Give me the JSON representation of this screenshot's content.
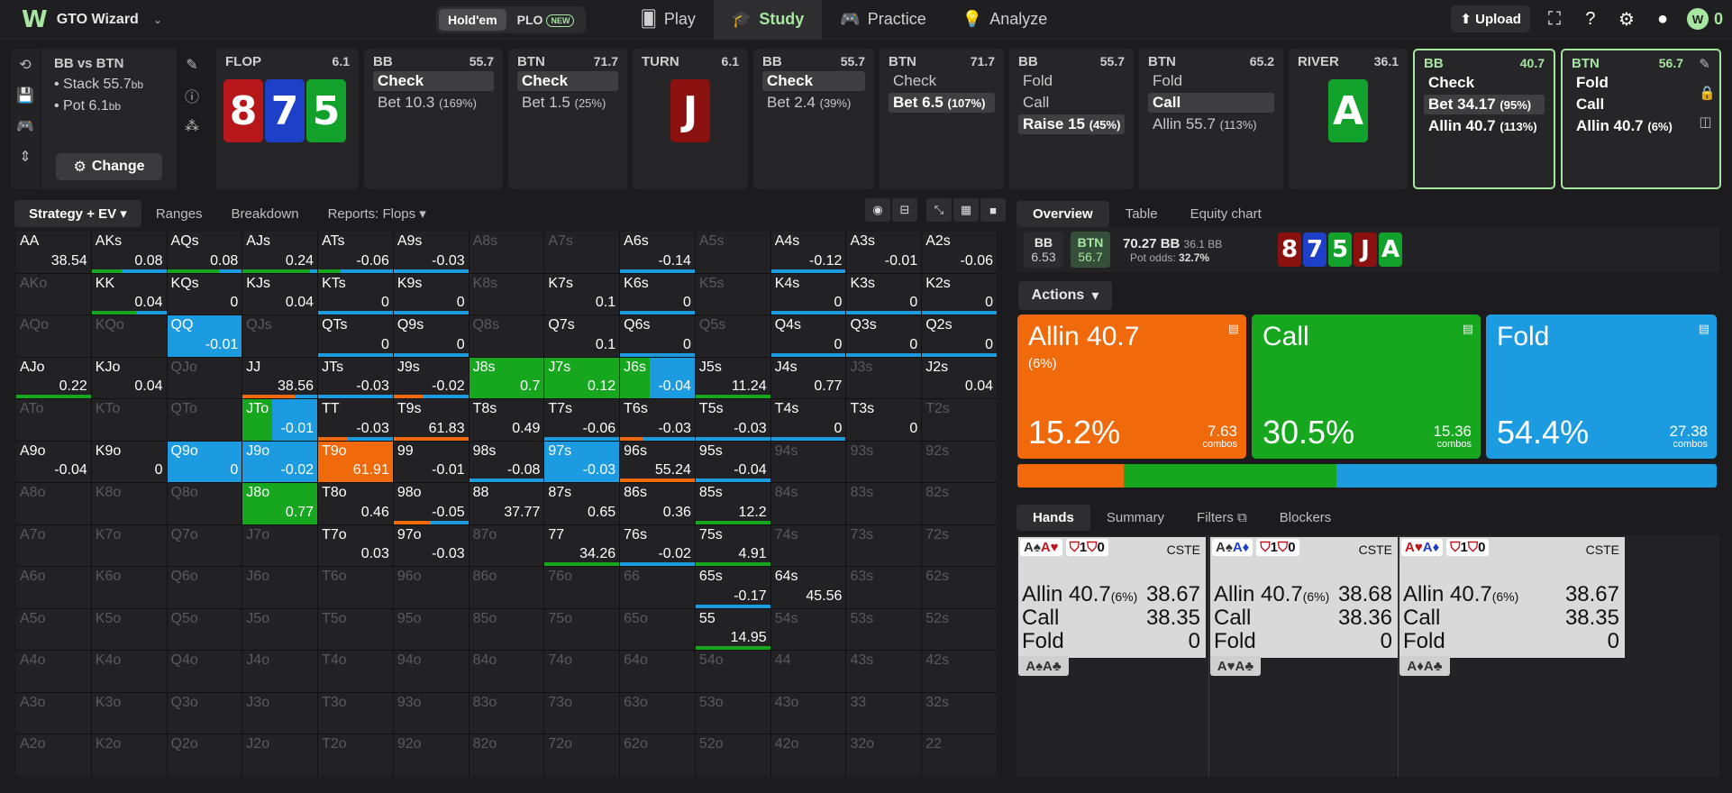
{
  "app": {
    "name": "GTO Wizard",
    "logo": "W"
  },
  "game_toggle": {
    "holdem": "Hold'em",
    "plo": "PLO",
    "new_badge": "NEW"
  },
  "nav": [
    {
      "label": "Play",
      "icon": "cards-icon"
    },
    {
      "label": "Study",
      "icon": "study-icon"
    },
    {
      "label": "Practice",
      "icon": "gamepad-icon"
    },
    {
      "label": "Analyze",
      "icon": "bulb-icon"
    }
  ],
  "top_right": {
    "upload": "Upload",
    "coins": "0"
  },
  "info": {
    "title": "BB vs BTN",
    "stack_label": "Stack 55.7",
    "pot_label": "Pot 6.1",
    "unit": "bb",
    "change": "Change"
  },
  "columns": {
    "flop": {
      "name": "FLOP",
      "pot": "6.1",
      "cards": [
        "8",
        "7",
        "5"
      ]
    },
    "bb1": {
      "name": "BB",
      "pot": "55.7",
      "actions": [
        {
          "label": "Check",
          "sub": ""
        },
        {
          "label": "Bet 10.3",
          "sub": "(169%)"
        }
      ]
    },
    "btn1": {
      "name": "BTN",
      "pot": "71.7",
      "actions": [
        {
          "label": "Check",
          "sub": ""
        },
        {
          "label": "Bet 1.5",
          "sub": "(25%)"
        }
      ]
    },
    "turn": {
      "name": "TURN",
      "pot": "6.1",
      "card": "J"
    },
    "bb2": {
      "name": "BB",
      "pot": "55.7",
      "actions": [
        {
          "label": "Check",
          "sub": ""
        },
        {
          "label": "Bet 2.4",
          "sub": "(39%)"
        }
      ]
    },
    "btn2": {
      "name": "BTN",
      "pot": "71.7",
      "actions": [
        {
          "label": "Check",
          "sub": ""
        },
        {
          "label": "Bet 6.5",
          "sub": "(107%)"
        }
      ]
    },
    "bb3": {
      "name": "BB",
      "pot": "55.7",
      "actions": [
        {
          "label": "Fold",
          "sub": ""
        },
        {
          "label": "Call",
          "sub": ""
        },
        {
          "label": "Raise 15",
          "sub": "(45%)"
        }
      ]
    },
    "btn3": {
      "name": "BTN",
      "pot": "65.2",
      "actions": [
        {
          "label": "Fold",
          "sub": ""
        },
        {
          "label": "Call",
          "sub": ""
        },
        {
          "label": "Allin 55.7",
          "sub": "(113%)"
        }
      ]
    },
    "river": {
      "name": "RIVER",
      "pot": "36.1",
      "card": "A"
    },
    "bb4": {
      "name": "BB",
      "pot": "40.7",
      "actions": [
        {
          "label": "Check",
          "sub": ""
        },
        {
          "label": "Bet 34.17",
          "sub": "(95%)"
        },
        {
          "label": "Allin 40.7",
          "sub": "(113%)"
        }
      ]
    },
    "btn4": {
      "name": "BTN",
      "pot": "56.7",
      "actions": [
        {
          "label": "Fold",
          "sub": ""
        },
        {
          "label": "Call",
          "sub": ""
        },
        {
          "label": "Allin 40.7",
          "sub": "(6%)"
        }
      ]
    }
  },
  "mid_tabs": [
    "Strategy + EV",
    "Ranges",
    "Breakdown",
    "Reports: Flops"
  ],
  "matrix": [
    [
      [
        "AA",
        "38.54",
        "",
        "n"
      ],
      [
        "AKs",
        "0.08",
        "",
        "g4b6"
      ],
      [
        "AQs",
        "0.08",
        "",
        "g7b3"
      ],
      [
        "AJs",
        "0.24",
        "",
        "g9b1"
      ],
      [
        "ATs",
        "-0.06",
        "",
        "g3b7"
      ],
      [
        "A9s",
        "-0.03",
        "",
        "b10"
      ],
      [
        "A8s",
        "",
        "d",
        ""
      ],
      [
        "A7s",
        "",
        "d",
        ""
      ],
      [
        "A6s",
        "-0.14",
        "",
        "b10"
      ],
      [
        "A5s",
        "",
        "d",
        ""
      ],
      [
        "A4s",
        "-0.12",
        "",
        "b10"
      ],
      [
        "A3s",
        "-0.01",
        "",
        "n"
      ],
      [
        "A2s",
        "-0.06",
        "",
        "n"
      ]
    ],
    [
      [
        "AKo",
        "",
        "d",
        ""
      ],
      [
        "KK",
        "0.04",
        "",
        "g6b4"
      ],
      [
        "KQs",
        "0",
        "",
        "n"
      ],
      [
        "KJs",
        "0.04",
        "",
        "n"
      ],
      [
        "KTs",
        "0",
        "",
        "b10"
      ],
      [
        "K9s",
        "0",
        "",
        "b10"
      ],
      [
        "K8s",
        "",
        "d",
        ""
      ],
      [
        "K7s",
        "0.1",
        "",
        "n"
      ],
      [
        "K6s",
        "0",
        "",
        "b10"
      ],
      [
        "K5s",
        "",
        "d",
        ""
      ],
      [
        "K4s",
        "0",
        "",
        "b10"
      ],
      [
        "K3s",
        "0",
        "",
        "b10"
      ],
      [
        "K2s",
        "0",
        "",
        "b10"
      ]
    ],
    [
      [
        "AQo",
        "",
        "d",
        ""
      ],
      [
        "KQo",
        "",
        "d",
        ""
      ],
      [
        "QQ",
        "-0.01",
        "",
        "B"
      ],
      [
        "QJs",
        "",
        "d",
        ""
      ],
      [
        "QTs",
        "0",
        "",
        "b10"
      ],
      [
        "Q9s",
        "0",
        "",
        "b10"
      ],
      [
        "Q8s",
        "",
        "d",
        ""
      ],
      [
        "Q7s",
        "0.1",
        "",
        "n"
      ],
      [
        "Q6s",
        "0",
        "",
        "b10"
      ],
      [
        "Q5s",
        "",
        "d",
        ""
      ],
      [
        "Q4s",
        "0",
        "",
        "b10"
      ],
      [
        "Q3s",
        "0",
        "",
        "b10"
      ],
      [
        "Q2s",
        "0",
        "",
        "b10"
      ]
    ],
    [
      [
        "AJo",
        "0.22",
        "",
        "g10"
      ],
      [
        "KJo",
        "0.04",
        "",
        "n"
      ],
      [
        "QJo",
        "",
        "d",
        ""
      ],
      [
        "JJ",
        "38.56",
        "",
        "o7b3"
      ],
      [
        "JTs",
        "-0.03",
        "",
        "b10"
      ],
      [
        "J9s",
        "-0.02",
        "",
        "o4b6"
      ],
      [
        "J8s",
        "0.7",
        "",
        "G"
      ],
      [
        "J7s",
        "0.12",
        "",
        "G"
      ],
      [
        "J6s",
        "-0.04",
        "",
        "GB"
      ],
      [
        "J5s",
        "11.24",
        "",
        "g10"
      ],
      [
        "J4s",
        "0.77",
        "",
        "n"
      ],
      [
        "J3s",
        "",
        "d",
        ""
      ],
      [
        "J2s",
        "0.04",
        "",
        "n"
      ]
    ],
    [
      [
        "ATo",
        "",
        "d",
        ""
      ],
      [
        "KTo",
        "",
        "d",
        ""
      ],
      [
        "QTo",
        "",
        "d",
        ""
      ],
      [
        "JTo",
        "-0.01",
        "",
        "GB"
      ],
      [
        "TT",
        "-0.03",
        "",
        "o4b6"
      ],
      [
        "T9s",
        "61.83",
        "",
        "o10"
      ],
      [
        "T8s",
        "0.49",
        "",
        "n"
      ],
      [
        "T7s",
        "-0.06",
        "",
        "b10"
      ],
      [
        "T6s",
        "-0.03",
        "",
        "o3b7"
      ],
      [
        "T5s",
        "-0.03",
        "",
        "b10"
      ],
      [
        "T4s",
        "0",
        "",
        "b10"
      ],
      [
        "T3s",
        "0",
        "",
        "n"
      ],
      [
        "T2s",
        "",
        "d",
        ""
      ]
    ],
    [
      [
        "A9o",
        "-0.04",
        "",
        "n"
      ],
      [
        "K9o",
        "0",
        "",
        "n"
      ],
      [
        "Q9o",
        "0",
        "",
        "B"
      ],
      [
        "J9o",
        "-0.02",
        "",
        "B"
      ],
      [
        "T9o",
        "61.91",
        "",
        "O"
      ],
      [
        "99",
        "-0.01",
        "",
        "n"
      ],
      [
        "98s",
        "-0.08",
        "",
        "b10"
      ],
      [
        "97s",
        "-0.03",
        "",
        "B"
      ],
      [
        "96s",
        "55.24",
        "",
        "o10"
      ],
      [
        "95s",
        "-0.04",
        "",
        "b10"
      ],
      [
        "94s",
        "",
        "d",
        ""
      ],
      [
        "93s",
        "",
        "d",
        ""
      ],
      [
        "92s",
        "",
        "d",
        ""
      ]
    ],
    [
      [
        "A8o",
        "",
        "d",
        ""
      ],
      [
        "K8o",
        "",
        "d",
        ""
      ],
      [
        "Q8o",
        "",
        "d",
        ""
      ],
      [
        "J8o",
        "0.77",
        "",
        "G"
      ],
      [
        "T8o",
        "0.46",
        "",
        "n"
      ],
      [
        "98o",
        "-0.05",
        "",
        "o5b5"
      ],
      [
        "88",
        "37.77",
        "",
        "n"
      ],
      [
        "87s",
        "0.65",
        "",
        "n"
      ],
      [
        "86s",
        "0.36",
        "",
        "n"
      ],
      [
        "85s",
        "12.2",
        "",
        "g10"
      ],
      [
        "84s",
        "",
        "d",
        ""
      ],
      [
        "83s",
        "",
        "d",
        ""
      ],
      [
        "82s",
        "",
        "d",
        ""
      ]
    ],
    [
      [
        "A7o",
        "",
        "d",
        ""
      ],
      [
        "K7o",
        "",
        "d",
        ""
      ],
      [
        "Q7o",
        "",
        "d",
        ""
      ],
      [
        "J7o",
        "",
        "d",
        ""
      ],
      [
        "T7o",
        "0.03",
        "",
        "n"
      ],
      [
        "97o",
        "-0.03",
        "",
        "n"
      ],
      [
        "87o",
        "",
        "d",
        ""
      ],
      [
        "77",
        "34.26",
        "",
        "g10"
      ],
      [
        "76s",
        "-0.02",
        "",
        "b10"
      ],
      [
        "75s",
        "4.91",
        "",
        "g10"
      ],
      [
        "74s",
        "",
        "d",
        ""
      ],
      [
        "73s",
        "",
        "d",
        ""
      ],
      [
        "72s",
        "",
        "d",
        ""
      ]
    ],
    [
      [
        "A6o",
        "",
        "d",
        ""
      ],
      [
        "K6o",
        "",
        "d",
        ""
      ],
      [
        "Q6o",
        "",
        "d",
        ""
      ],
      [
        "J6o",
        "",
        "d",
        ""
      ],
      [
        "T6o",
        "",
        "d",
        ""
      ],
      [
        "96o",
        "",
        "d",
        ""
      ],
      [
        "86o",
        "",
        "d",
        ""
      ],
      [
        "76o",
        "",
        "d",
        ""
      ],
      [
        "66",
        "",
        "d",
        ""
      ],
      [
        "65s",
        "-0.17",
        "",
        "b10"
      ],
      [
        "64s",
        "45.56",
        "",
        "n"
      ],
      [
        "63s",
        "",
        "d",
        ""
      ],
      [
        "62s",
        "",
        "d",
        ""
      ]
    ],
    [
      [
        "A5o",
        "",
        "d",
        ""
      ],
      [
        "K5o",
        "",
        "d",
        ""
      ],
      [
        "Q5o",
        "",
        "d",
        ""
      ],
      [
        "J5o",
        "",
        "d",
        ""
      ],
      [
        "T5o",
        "",
        "d",
        ""
      ],
      [
        "95o",
        "",
        "d",
        ""
      ],
      [
        "85o",
        "",
        "d",
        ""
      ],
      [
        "75o",
        "",
        "d",
        ""
      ],
      [
        "65o",
        "",
        "d",
        ""
      ],
      [
        "55",
        "14.95",
        "",
        "g10"
      ],
      [
        "54s",
        "",
        "d",
        ""
      ],
      [
        "53s",
        "",
        "d",
        ""
      ],
      [
        "52s",
        "",
        "d",
        ""
      ]
    ],
    [
      [
        "A4o",
        "",
        "d",
        ""
      ],
      [
        "K4o",
        "",
        "d",
        ""
      ],
      [
        "Q4o",
        "",
        "d",
        ""
      ],
      [
        "J4o",
        "",
        "d",
        ""
      ],
      [
        "T4o",
        "",
        "d",
        ""
      ],
      [
        "94o",
        "",
        "d",
        ""
      ],
      [
        "84o",
        "",
        "d",
        ""
      ],
      [
        "74o",
        "",
        "d",
        ""
      ],
      [
        "64o",
        "",
        "d",
        ""
      ],
      [
        "54o",
        "",
        "d",
        ""
      ],
      [
        "44",
        "",
        "d",
        ""
      ],
      [
        "43s",
        "",
        "d",
        ""
      ],
      [
        "42s",
        "",
        "d",
        ""
      ]
    ],
    [
      [
        "A3o",
        "",
        "d",
        ""
      ],
      [
        "K3o",
        "",
        "d",
        ""
      ],
      [
        "Q3o",
        "",
        "d",
        ""
      ],
      [
        "J3o",
        "",
        "d",
        ""
      ],
      [
        "T3o",
        "",
        "d",
        ""
      ],
      [
        "93o",
        "",
        "d",
        ""
      ],
      [
        "83o",
        "",
        "d",
        ""
      ],
      [
        "73o",
        "",
        "d",
        ""
      ],
      [
        "63o",
        "",
        "d",
        ""
      ],
      [
        "53o",
        "",
        "d",
        ""
      ],
      [
        "43o",
        "",
        "d",
        ""
      ],
      [
        "33",
        "",
        "d",
        ""
      ],
      [
        "32s",
        "",
        "d",
        ""
      ]
    ],
    [
      [
        "A2o",
        "",
        "d",
        ""
      ],
      [
        "K2o",
        "",
        "d",
        ""
      ],
      [
        "Q2o",
        "",
        "d",
        ""
      ],
      [
        "J2o",
        "",
        "d",
        ""
      ],
      [
        "T2o",
        "",
        "d",
        ""
      ],
      [
        "92o",
        "",
        "d",
        ""
      ],
      [
        "82o",
        "",
        "d",
        ""
      ],
      [
        "72o",
        "",
        "d",
        ""
      ],
      [
        "62o",
        "",
        "d",
        ""
      ],
      [
        "52o",
        "",
        "d",
        ""
      ],
      [
        "42o",
        "",
        "d",
        ""
      ],
      [
        "32o",
        "",
        "d",
        ""
      ],
      [
        "22",
        "",
        "d",
        ""
      ]
    ]
  ],
  "right_tabs": [
    "Overview",
    "Table",
    "Equity chart"
  ],
  "overview": {
    "bb_label": "BB",
    "bb_val": "6.53",
    "btn_label": "BTN",
    "btn_val": "56.7",
    "pot_main": "70.27 BB",
    "pot_alt": "36.1 BB",
    "pot_odds_label": "Pot odds:",
    "pot_odds": "32.7%",
    "board": [
      "8",
      "7",
      "5",
      "J",
      "A"
    ]
  },
  "actions_label": "Actions",
  "action_boxes": [
    {
      "name": "Allin 40.7",
      "sub": "(6%)",
      "pct": "15.2%",
      "combos": "7.63",
      "combos_label": "combos",
      "color": "#f06a0c",
      "frac": 0.152
    },
    {
      "name": "Call",
      "sub": "",
      "pct": "30.5%",
      "combos": "15.36",
      "combos_label": "combos",
      "color": "#17a71f",
      "frac": 0.305
    },
    {
      "name": "Fold",
      "sub": "",
      "pct": "54.4%",
      "combos": "27.38",
      "combos_label": "combos",
      "color": "#1d9be0",
      "frac": 0.544
    }
  ],
  "bottom_tabs": [
    "Hands",
    "Summary",
    "Filters",
    "Blockers"
  ],
  "hand_cards": [
    {
      "c1": "A♠",
      "c2": "A♥",
      "badge": "1",
      "badge2": "0",
      "tag": "CSTE",
      "lines": [
        {
          "a": "Allin 40.7",
          "s": "(6%)",
          "v": "38.67"
        },
        {
          "a": "Call",
          "s": "",
          "v": "38.35"
        },
        {
          "a": "Fold",
          "s": "",
          "v": "0"
        }
      ],
      "combo": "A♠A♣"
    },
    {
      "c1": "A♠",
      "c2": "A♦",
      "badge": "1",
      "badge2": "0",
      "tag": "CSTE",
      "lines": [
        {
          "a": "Allin 40.7",
          "s": "(6%)",
          "v": "38.68"
        },
        {
          "a": "Call",
          "s": "",
          "v": "38.36"
        },
        {
          "a": "Fold",
          "s": "",
          "v": "0"
        }
      ],
      "combo": "A♥A♣"
    },
    {
      "c1": "A♥",
      "c2": "A♦",
      "badge": "1",
      "badge2": "0",
      "tag": "CSTE",
      "lines": [
        {
          "a": "Allin 40.7",
          "s": "(6%)",
          "v": "38.67"
        },
        {
          "a": "Call",
          "s": "",
          "v": "38.35"
        },
        {
          "a": "Fold",
          "s": "",
          "v": "0"
        }
      ],
      "combo": "A♦A♣"
    }
  ]
}
